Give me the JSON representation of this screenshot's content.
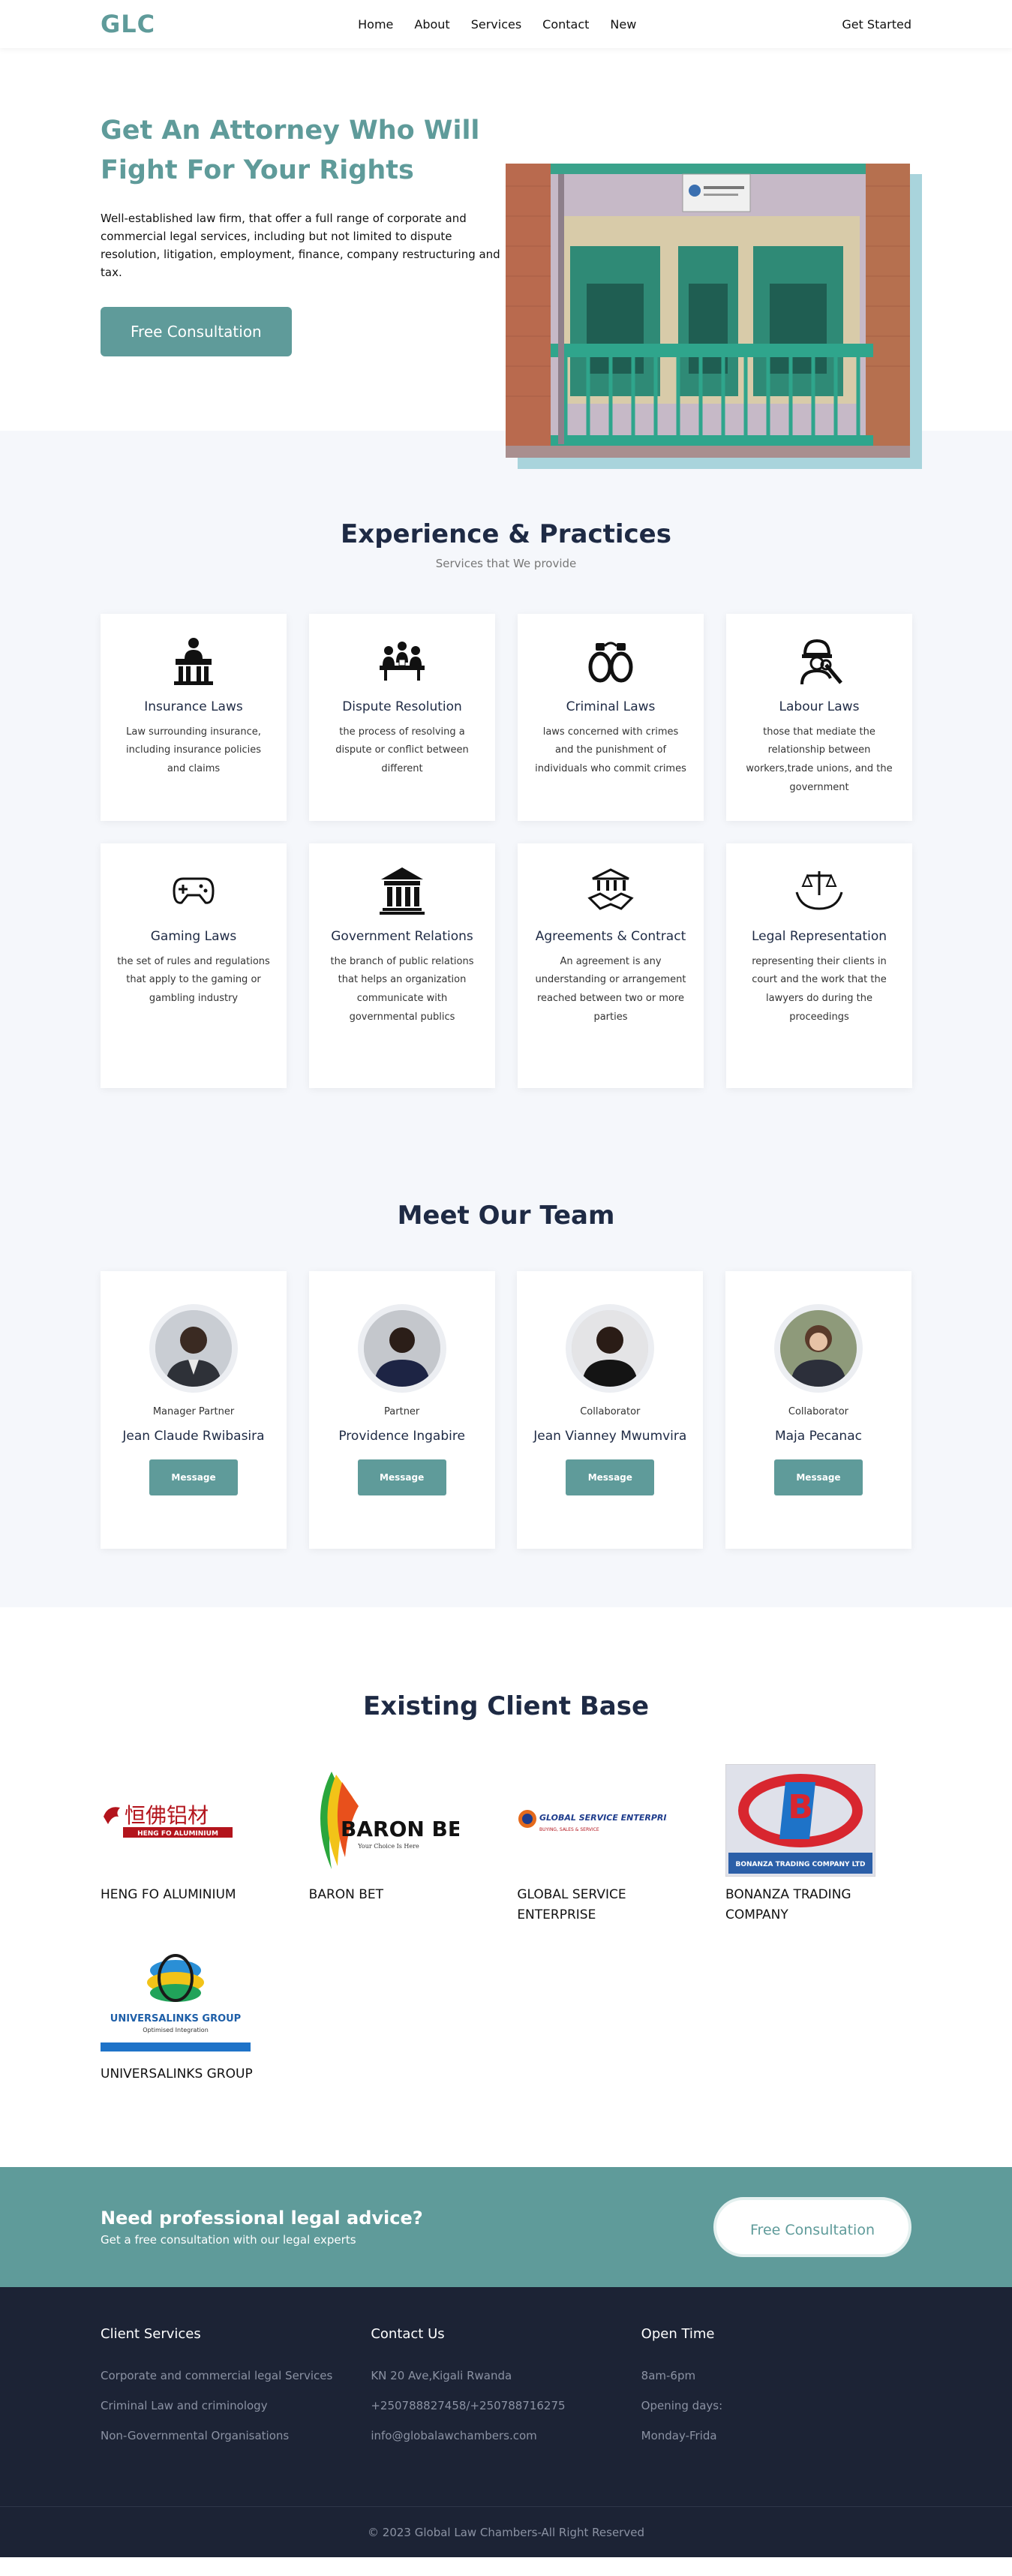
{
  "nav": {
    "logo": "GLC",
    "links": [
      "Home",
      "About",
      "Services",
      "Contact",
      "New"
    ],
    "cta": "Get Started"
  },
  "hero": {
    "title": "Get An Attorney Who Will Fight For Your Rights",
    "text": "Well-established law firm, that offer a full range of corporate and commercial legal services, including but not limited to dispute resolution, litigation, employment, finance, company restructuring and tax.",
    "button": "Free Consultation"
  },
  "practices": {
    "title": "Experience & Practices",
    "subtitle": "Services that We provide",
    "cards": [
      {
        "icon": "judge-podium-icon",
        "title": "Insurance Laws",
        "text": "Law surrounding insurance, including insurance policies and claims"
      },
      {
        "icon": "meeting-table-icon",
        "title": "Dispute Resolution",
        "text": "the process of resolving a dispute or conflict between different"
      },
      {
        "icon": "handcuffs-icon",
        "title": "Criminal Laws",
        "text": "laws concerned with crimes and the punishment of individuals who commit crimes"
      },
      {
        "icon": "worker-tools-icon",
        "title": "Labour Laws",
        "text": "those that mediate the relationship between workers,trade unions, and the government"
      },
      {
        "icon": "gamepad-icon",
        "title": "Gaming Laws",
        "text": "the set of rules and regulations that apply to the gaming or gambling industry"
      },
      {
        "icon": "government-building-icon",
        "title": "Government Relations",
        "text": "the branch of public relations that helps an organization communicate with governmental publics"
      },
      {
        "icon": "handshake-icon",
        "title": "Agreements & Contract",
        "text": "An agreement is any understanding or arrangement reached between two or more parties"
      },
      {
        "icon": "scales-hands-icon",
        "title": "Legal Representation",
        "text": "representing their clients in court and the work that the lawyers do during the proceedings"
      }
    ]
  },
  "team": {
    "title": "Meet Our Team",
    "members": [
      {
        "role": "Manager Partner",
        "name": "Jean Claude Rwibasira",
        "button": "Message"
      },
      {
        "role": "Partner",
        "name": "Providence Ingabire",
        "button": "Message"
      },
      {
        "role": "Collaborator",
        "name": "Jean Vianney Mwumvira",
        "button": "Message"
      },
      {
        "role": "Collaborator",
        "name": "Maja Pecanac",
        "button": "Message"
      }
    ]
  },
  "clients": {
    "title": "Existing Client Base",
    "items": [
      {
        "name": "HENG FO ALUMINIUM",
        "logo_text": "恒佛铝材",
        "logo_sub": "HENG FO ALUMINIUM"
      },
      {
        "name": "BARON BET",
        "logo_text": "BARON BET",
        "logo_sub": "Your Choice Is Here"
      },
      {
        "name": "GLOBAL SERVICE ENTERPRISE",
        "logo_text": "GLOBAL SERVICE ENTERPRISE",
        "logo_sub": "BUYING, SALES & SERVICE"
      },
      {
        "name": "BONANZA TRADING COMPANY",
        "logo_text": "BONANZA TRADING COMPANY LTD",
        "logo_sub": ""
      },
      {
        "name": "UNIVERSALINKS GROUP",
        "logo_text": "UNIVERSALINKS GROUP",
        "logo_sub": "Optimised Integration"
      }
    ]
  },
  "cta": {
    "title": "Need professional legal advice?",
    "subtitle": "Get a free consultation with our legal experts",
    "button": "Free Consultation"
  },
  "footer": {
    "columns": [
      {
        "title": "Client Services",
        "items": [
          "Corporate and commercial legal Services",
          "Criminal Law and criminology",
          "Non-Governmental Organisations"
        ]
      },
      {
        "title": "Contact Us",
        "items": [
          "KN 20 Ave,Kigali Rwanda",
          "+250788827458/+250788716275",
          "info@globalawchambers.com"
        ]
      },
      {
        "title": "Open Time",
        "items": [
          "8am-6pm",
          "Opening days:",
          "Monday-Frida"
        ]
      }
    ],
    "copyright": "© 2023 Global Law Chambers-All Right Reserved"
  },
  "colors": {
    "accent": "#5f9b9a",
    "navy": "#1e2a44",
    "footer": "#1c2335"
  }
}
